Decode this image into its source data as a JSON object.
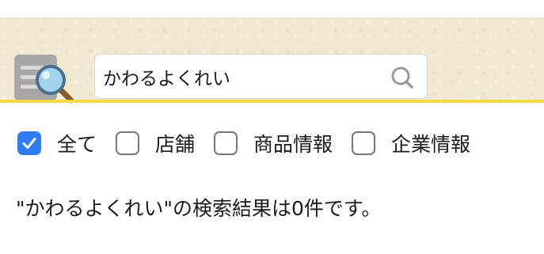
{
  "search": {
    "value": "かわるよくれい",
    "logo_icon": "search-document-magnifier-icon",
    "button_icon": "search-icon"
  },
  "filters": [
    {
      "label": "全て",
      "checked": true
    },
    {
      "label": "店舗",
      "checked": false
    },
    {
      "label": "商品情報",
      "checked": false
    },
    {
      "label": "企業情報",
      "checked": false
    }
  ],
  "result": {
    "text": "\"かわるよくれい\"の検索結果は0件です。"
  },
  "colors": {
    "header_bg": "#f1e8d2",
    "header_accent": "#f3d84c",
    "checkbox_checked": "#2f7bf0"
  }
}
